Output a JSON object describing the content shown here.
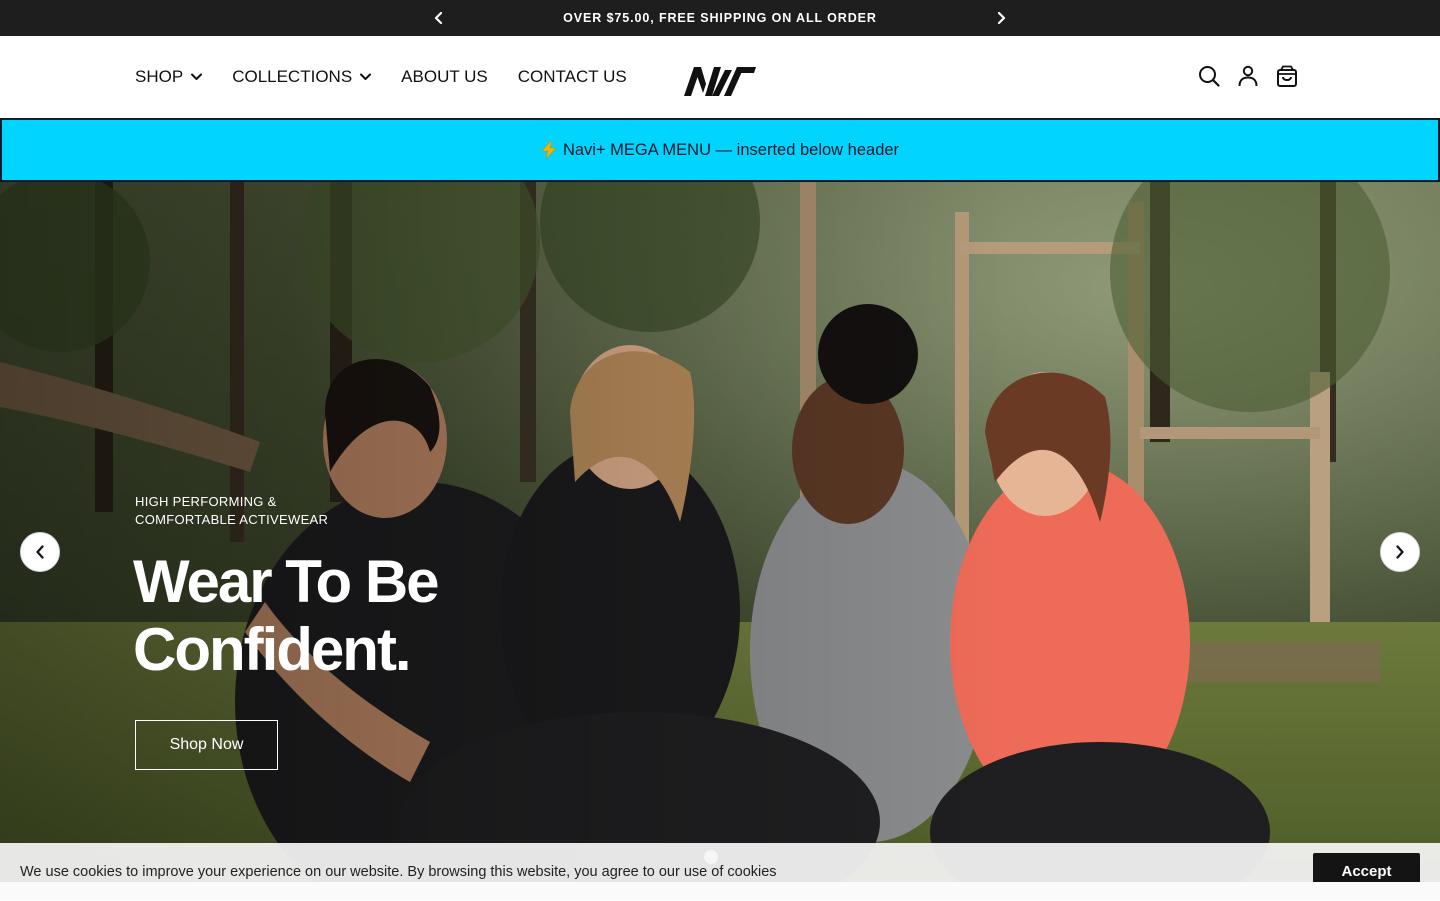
{
  "announcement": {
    "text": "OVER $75.00, FREE SHIPPING ON ALL ORDER",
    "prev_icon": "chevron-left-icon",
    "next_icon": "chevron-right-icon"
  },
  "header": {
    "nav": [
      {
        "label": "SHOP",
        "has_dropdown": true
      },
      {
        "label": "COLLECTIONS",
        "has_dropdown": true
      },
      {
        "label": "ABOUT US",
        "has_dropdown": false
      },
      {
        "label": "CONTACT US",
        "has_dropdown": false
      }
    ],
    "logo": "NW",
    "icons": [
      "search-icon",
      "account-icon",
      "cart-icon"
    ]
  },
  "mega_menu": {
    "text": "Navi+ MEGA MENU — inserted below header",
    "background": "#00d4ff"
  },
  "hero": {
    "subtitle_line1": "HIGH PERFORMING &",
    "subtitle_line2": "COMFORTABLE ACTIVEWEAR",
    "heading_line1": "Wear To Be",
    "heading_line2": "Confident.",
    "cta_label": "Shop Now",
    "slide_count": 1,
    "active_slide": 1
  },
  "cookie": {
    "text": "We use cookies to improve your experience on our website. By browsing this website, you agree to our use of cookies",
    "accept_label": "Accept"
  }
}
